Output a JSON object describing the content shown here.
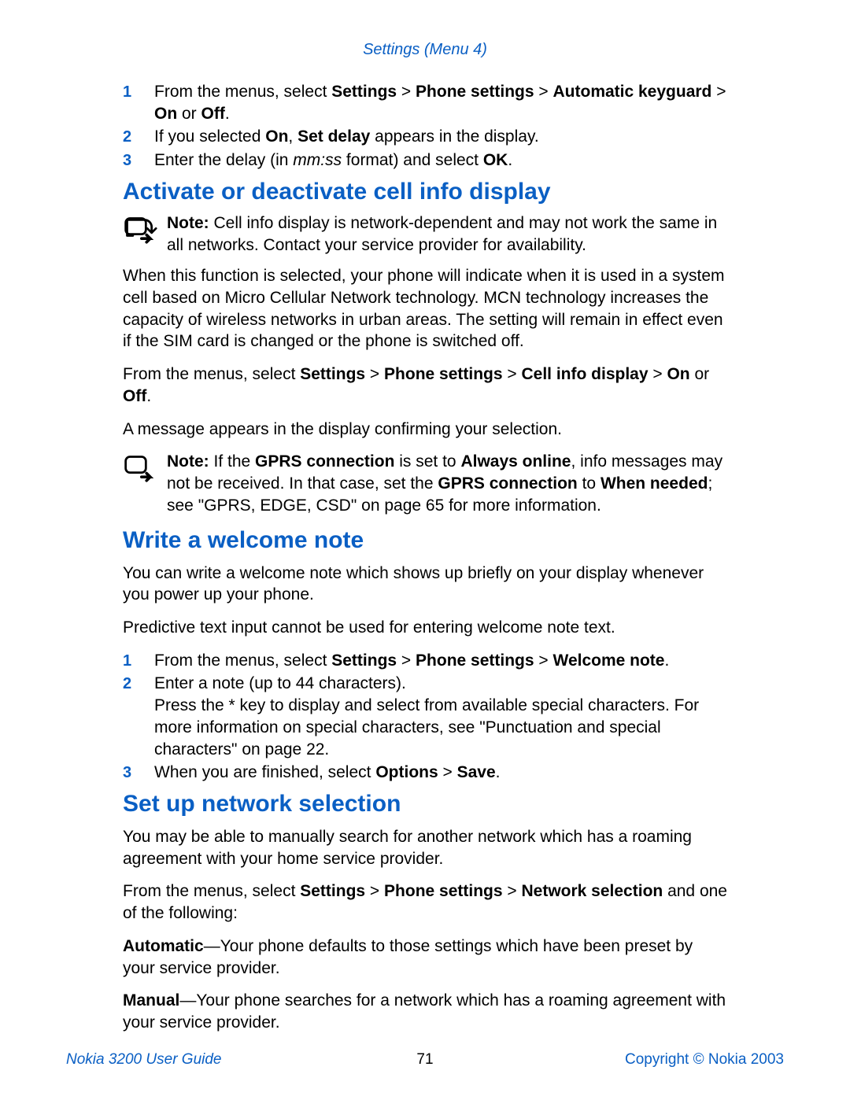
{
  "header": {
    "running": "Settings (Menu 4)"
  },
  "list_top": {
    "items": [
      {
        "num": "1",
        "parts": [
          {
            "t": "From the menus, select "
          },
          {
            "t": "Settings",
            "b": true
          },
          {
            "t": " > "
          },
          {
            "t": "Phone settings",
            "b": true
          },
          {
            "t": " > "
          },
          {
            "t": "Automatic keyguard",
            "b": true
          },
          {
            "t": " > "
          },
          {
            "t": "On",
            "b": true
          },
          {
            "t": " or "
          },
          {
            "t": "Off",
            "b": true
          },
          {
            "t": "."
          }
        ]
      },
      {
        "num": "2",
        "parts": [
          {
            "t": "If you selected "
          },
          {
            "t": "On",
            "b": true
          },
          {
            "t": ", "
          },
          {
            "t": "Set delay",
            "b": true
          },
          {
            "t": " appears in the display."
          }
        ]
      },
      {
        "num": "3",
        "parts": [
          {
            "t": "Enter the delay (in "
          },
          {
            "t": "mm:ss",
            "i": true
          },
          {
            "t": " format) and select "
          },
          {
            "t": "OK",
            "b": true
          },
          {
            "t": "."
          }
        ]
      }
    ]
  },
  "section1": {
    "title": "Activate or deactivate cell info display",
    "note1_parts": [
      {
        "t": "Note:",
        "b": true
      },
      {
        "t": " Cell info display is network-dependent and may not work the same in all networks. Contact your service provider for availability."
      }
    ],
    "para1": "When this function is selected, your phone will indicate when it is used in a system cell based on Micro Cellular Network technology. MCN technology increases the capacity of wireless networks in urban areas. The setting will remain in effect even if the SIM card is changed or the phone is switched off.",
    "para2_parts": [
      {
        "t": "From the menus, select "
      },
      {
        "t": "Settings",
        "b": true
      },
      {
        "t": " > "
      },
      {
        "t": "Phone settings",
        "b": true
      },
      {
        "t": " > "
      },
      {
        "t": "Cell info display",
        "b": true
      },
      {
        "t": " > "
      },
      {
        "t": "On",
        "b": true
      },
      {
        "t": " or "
      },
      {
        "t": "Off",
        "b": true
      },
      {
        "t": "."
      }
    ],
    "para3": "A message appears in the display confirming your selection.",
    "note2_parts": [
      {
        "t": "Note:",
        "b": true
      },
      {
        "t": " If the "
      },
      {
        "t": "GPRS connection",
        "b": true
      },
      {
        "t": " is set to "
      },
      {
        "t": "Always online",
        "b": true
      },
      {
        "t": ", info messages may not be received. In that case, set the "
      },
      {
        "t": "GPRS connection",
        "b": true
      },
      {
        "t": " to "
      },
      {
        "t": "When needed",
        "b": true
      },
      {
        "t": "; see \"GPRS, EDGE, CSD\" on page 65 for more information."
      }
    ]
  },
  "section2": {
    "title": "Write a welcome note",
    "para1": "You can write a welcome note which shows up briefly on your display whenever you power up your phone.",
    "para2": " Predictive text input cannot be used for entering welcome note text.",
    "list": [
      {
        "num": "1",
        "parts": [
          {
            "t": "From the menus, select "
          },
          {
            "t": "Settings",
            "b": true
          },
          {
            "t": " > "
          },
          {
            "t": "Phone settings",
            "b": true
          },
          {
            "t": " > "
          },
          {
            "t": "Welcome note",
            "b": true
          },
          {
            "t": "."
          }
        ]
      },
      {
        "num": "2",
        "parts": [
          {
            "t": "Enter a note (up to 44 characters)."
          }
        ],
        "extra": "Press the * key to display and select from available special characters. For more information on special characters, see \"Punctuation and special characters\" on page 22."
      },
      {
        "num": "3",
        "parts": [
          {
            "t": "When you are finished, select "
          },
          {
            "t": "Options",
            "b": true
          },
          {
            "t": " > "
          },
          {
            "t": "Save",
            "b": true
          },
          {
            "t": "."
          }
        ]
      }
    ]
  },
  "section3": {
    "title": "Set up network selection",
    "para1": "You may be able to manually search for another network which has a roaming agreement with your home service provider.",
    "para2_parts": [
      {
        "t": "From the menus, select "
      },
      {
        "t": "Settings",
        "b": true
      },
      {
        "t": " > "
      },
      {
        "t": "Phone settings",
        "b": true
      },
      {
        "t": " > "
      },
      {
        "t": "Network selection",
        "b": true
      },
      {
        "t": " and one of the following:"
      }
    ],
    "opt1_parts": [
      {
        "t": "Automatic",
        "b": true
      },
      {
        "t": "—Your phone defaults to those settings which have been preset by your service provider."
      }
    ],
    "opt2_parts": [
      {
        "t": "Manual",
        "b": true
      },
      {
        "t": "—Your phone searches for a network which has a roaming agreement with your service provider."
      }
    ]
  },
  "footer": {
    "left": "Nokia 3200 User Guide",
    "page": "71",
    "right": "Copyright © Nokia 2003"
  }
}
